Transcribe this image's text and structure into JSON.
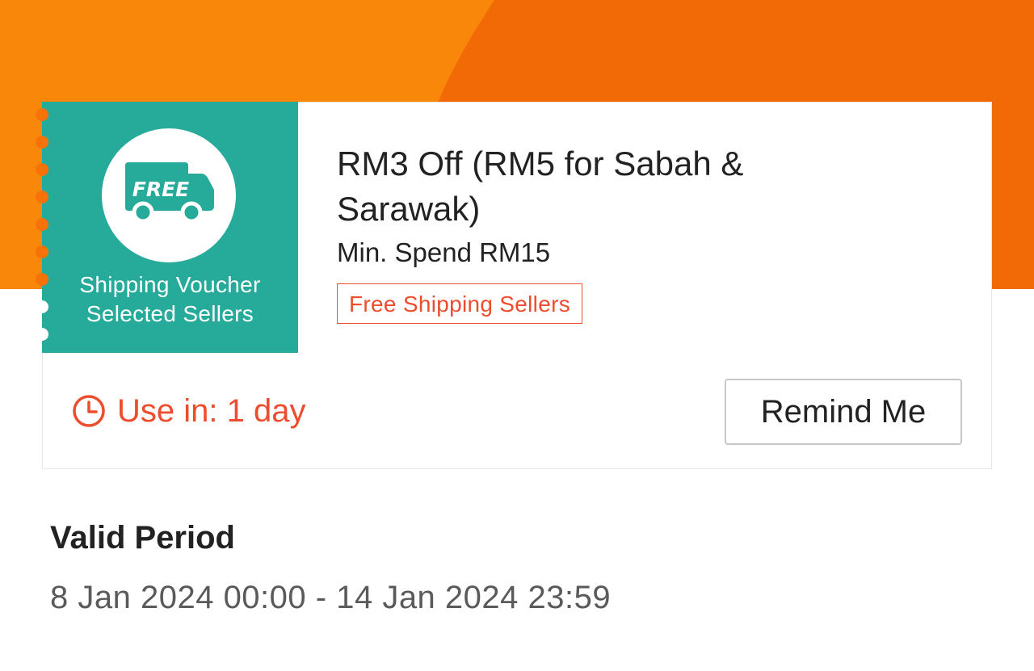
{
  "voucher": {
    "badge_text": "FREE",
    "type_line1": "Shipping Voucher",
    "type_line2": "Selected Sellers",
    "title": "RM3 Off (RM5 for Sabah & Sarawak)",
    "min_spend": "Min. Spend RM15",
    "tag": "Free Shipping Sellers",
    "icon": "free-shipping-truck-icon"
  },
  "action_row": {
    "use_in": "Use in: 1 day",
    "clock_icon": "clock-icon",
    "remind_button": "Remind Me"
  },
  "validity": {
    "heading": "Valid Period",
    "dates": "8 Jan 2024 00:00 - 14 Jan 2024 23:59"
  },
  "colors": {
    "banner_orange": "#f26a05",
    "banner_light": "#f8870a",
    "voucher_teal": "#26aa99",
    "accent_red": "#ee4d2d"
  }
}
